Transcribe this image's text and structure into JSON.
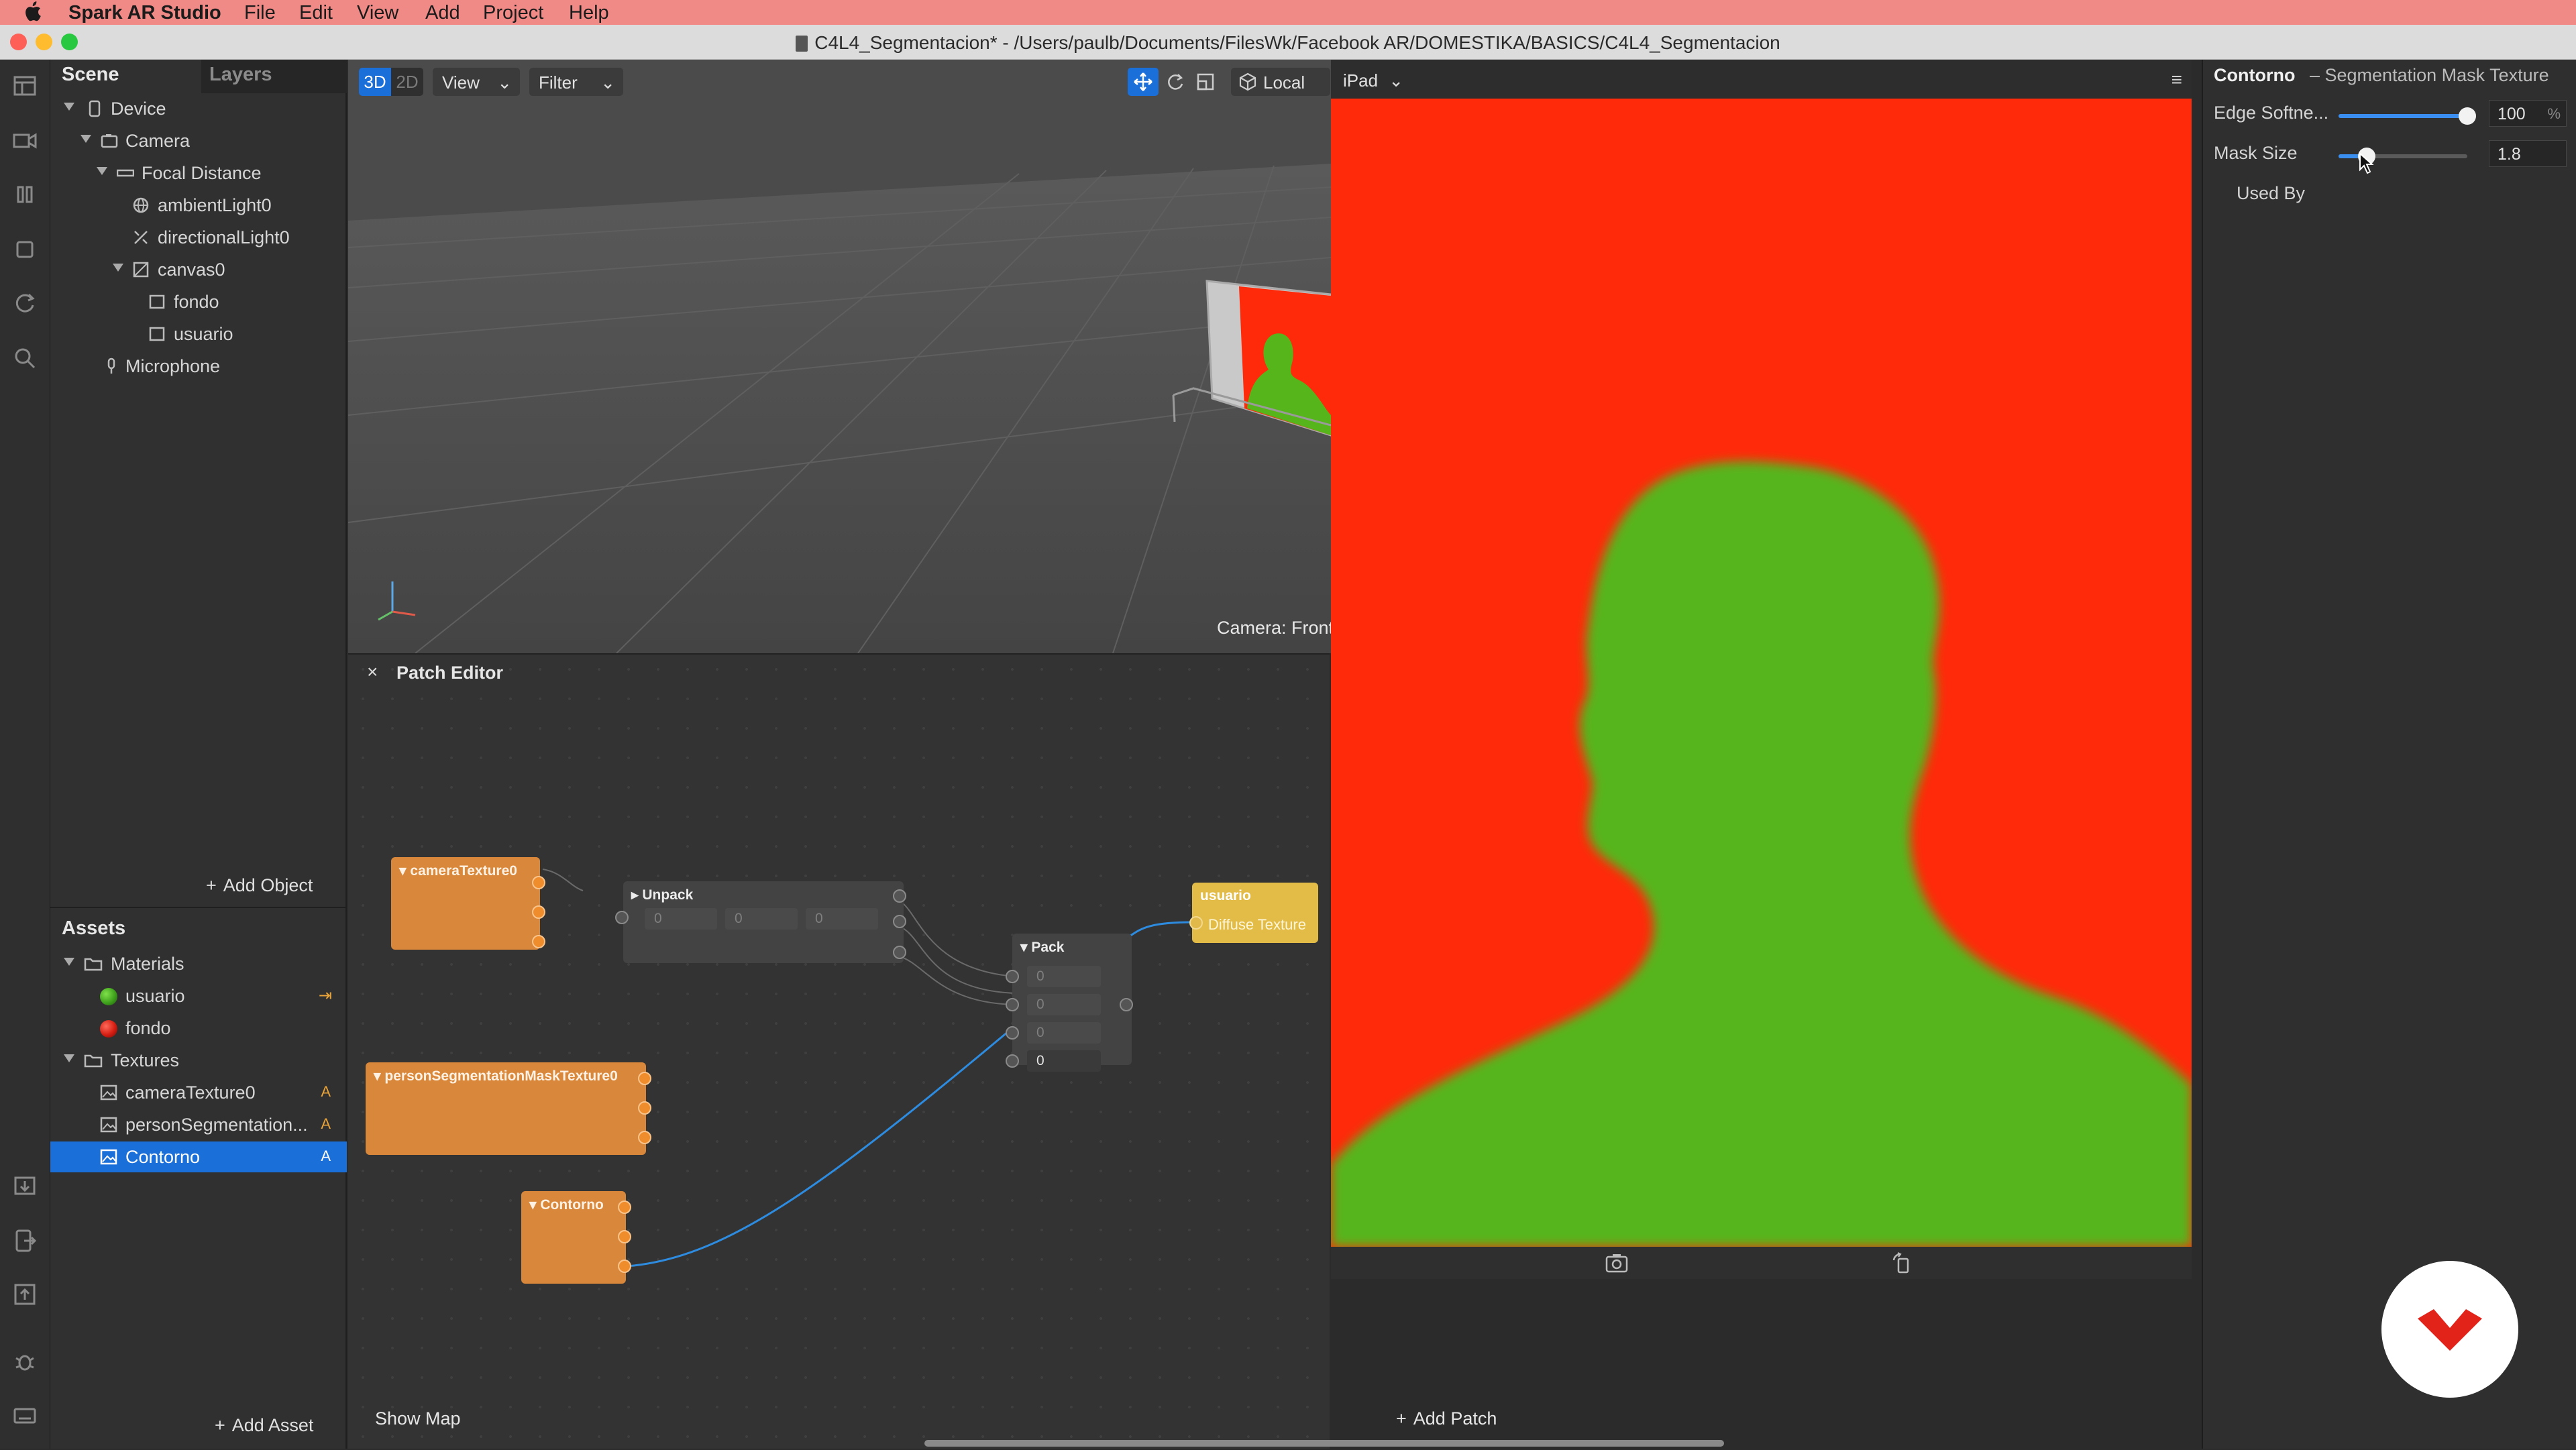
{
  "menubar": {
    "app_name": "Spark AR Studio",
    "items": [
      "File",
      "Edit",
      "View",
      "Add",
      "Project",
      "Help"
    ]
  },
  "window": {
    "title": "C4L4_Segmentacion* - /Users/paulb/Documents/FilesWk/Facebook AR/DOMESTIKA/BASICS/C4L4_Segmentacion"
  },
  "toolstrip": {
    "icons": [
      "scene-icon",
      "video-icon",
      "pause-icon",
      "stop-icon",
      "refresh-icon",
      "search-icon",
      "import-icon",
      "export-icon",
      "upload-icon",
      "bug-icon",
      "keyboard-icon"
    ]
  },
  "scene": {
    "tabs": [
      "Scene",
      "Layers"
    ],
    "items": [
      {
        "label": "Device",
        "icon": "device-icon"
      },
      {
        "label": "Camera",
        "icon": "camera-icon"
      },
      {
        "label": "Focal Distance",
        "icon": "ruler-icon"
      },
      {
        "label": "ambientLight0",
        "icon": "ambient-light-icon"
      },
      {
        "label": "directionalLight0",
        "icon": "directional-light-icon"
      },
      {
        "label": "canvas0",
        "icon": "canvas-icon"
      },
      {
        "label": "fondo",
        "icon": "rectangle-icon"
      },
      {
        "label": "usuario",
        "icon": "rectangle-icon"
      },
      {
        "label": "Microphone",
        "icon": "microphone-icon"
      }
    ],
    "add_object": "Add Object"
  },
  "assets": {
    "title": "Assets",
    "folders": [
      "Materials",
      "Textures"
    ],
    "materials": [
      {
        "label": "usuario",
        "color": "#3fa21c"
      },
      {
        "label": "fondo",
        "color": "#d51d12"
      }
    ],
    "textures": [
      {
        "label": "cameraTexture0",
        "badge": "A"
      },
      {
        "label": "personSegmentation...",
        "badge": "A"
      },
      {
        "label": "Contorno",
        "badge": "A"
      }
    ],
    "add_asset": "Add Asset"
  },
  "viewport": {
    "mode_3d": "3D",
    "mode_2d": "2D",
    "view_label": "View",
    "filter_label": "Filter",
    "local_label": "Local",
    "device_label": "iPad",
    "camera_label": "Camera: Front"
  },
  "patch_editor": {
    "title": "Patch Editor",
    "show_map": "Show Map",
    "add_patch": "Add Patch",
    "nodes": {
      "camera_texture": "cameraTexture0",
      "unpack": "Unpack",
      "unpack_values": [
        "0",
        "0",
        "0"
      ],
      "pack": "Pack",
      "pack_values": [
        "0",
        "0",
        "0",
        "0"
      ],
      "usuario": "usuario",
      "diffuse_texture": "Diffuse Texture",
      "person_mask": "personSegmentationMaskTexture0",
      "contorno": "Contorno"
    }
  },
  "inspector": {
    "title": "Contorno",
    "subtitle": "– Segmentation Mask Texture",
    "edge_softness_label": "Edge Softne...",
    "edge_softness_value": "100",
    "edge_softness_unit": "%",
    "edge_softness_level": 1.0,
    "mask_size_label": "Mask Size",
    "mask_size_value": "1.8",
    "mask_size_level": 0.22,
    "used_by": "Used By"
  },
  "colors": {
    "accent_blue": "#1b6fd9",
    "preview_background": "#ff2a0a",
    "preview_silhouette": "#56b51a",
    "patch_orange": "#d9873a",
    "patch_yellow": "#e2bc47"
  }
}
